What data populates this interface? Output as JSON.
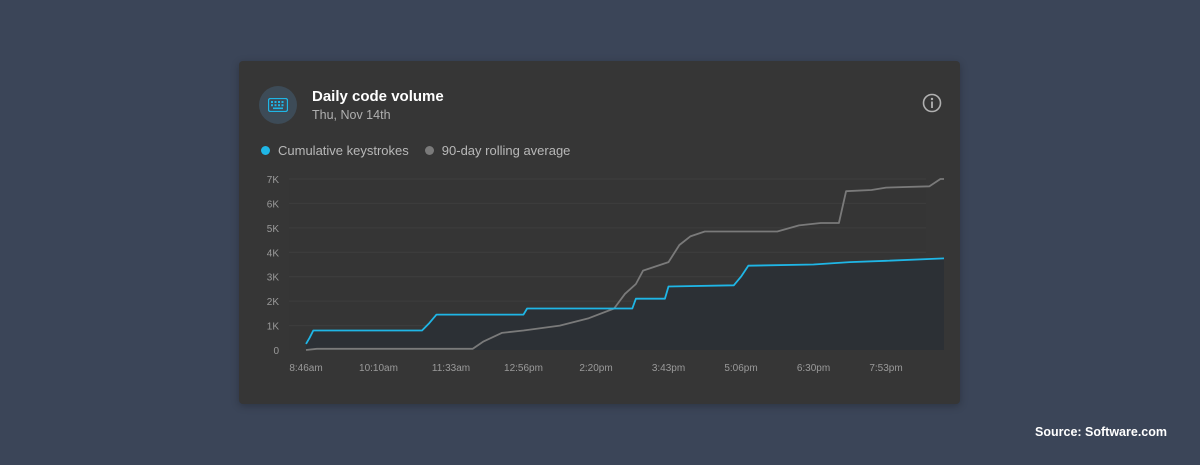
{
  "card": {
    "title": "Daily code volume",
    "subtitle": "Thu, Nov 14th",
    "icon": "keyboard-icon",
    "info_icon": "info-icon"
  },
  "legend": [
    {
      "label": "Cumulative keystrokes",
      "color": "#1fb6e6"
    },
    {
      "label": "90-day rolling average",
      "color": "#7a7a7a"
    }
  ],
  "source": "Source: Software.com",
  "colors": {
    "page_bg": "#3b4558",
    "card_bg": "#363636",
    "keystrokes": "#1fb6e6",
    "average": "#7a7a7a"
  },
  "chart_data": {
    "type": "line",
    "title": "Daily code volume",
    "x_ticks": [
      "8:46am",
      "10:10am",
      "11:33am",
      "12:56pm",
      "2:20pm",
      "3:43pm",
      "5:06pm",
      "6:30pm",
      "7:53pm"
    ],
    "y_ticks": [
      "0",
      "1K",
      "2K",
      "3K",
      "4K",
      "5K",
      "6K",
      "7K"
    ],
    "ylim": [
      0,
      7000
    ],
    "grid": true,
    "series": [
      {
        "name": "Cumulative keystrokes",
        "color": "#1fb6e6",
        "fill": true,
        "points": [
          [
            0,
            250
          ],
          [
            0.05,
            500
          ],
          [
            0.1,
            800
          ],
          [
            1.6,
            800
          ],
          [
            1.7,
            1100
          ],
          [
            1.8,
            1450
          ],
          [
            3.0,
            1450
          ],
          [
            3.05,
            1700
          ],
          [
            4.5,
            1700
          ],
          [
            4.55,
            2100
          ],
          [
            4.95,
            2100
          ],
          [
            5.0,
            2600
          ],
          [
            5.9,
            2650
          ],
          [
            6.0,
            3000
          ],
          [
            6.1,
            3450
          ],
          [
            7.0,
            3500
          ],
          [
            7.5,
            3600
          ],
          [
            8.0,
            3650
          ],
          [
            8.8,
            3750
          ]
        ]
      },
      {
        "name": "90-day rolling average",
        "color": "#7a7a7a",
        "fill": false,
        "points": [
          [
            0,
            0
          ],
          [
            0.15,
            50
          ],
          [
            2.3,
            50
          ],
          [
            2.45,
            350
          ],
          [
            2.7,
            700
          ],
          [
            3.0,
            800
          ],
          [
            3.5,
            1000
          ],
          [
            3.9,
            1300
          ],
          [
            4.25,
            1700
          ],
          [
            4.4,
            2300
          ],
          [
            4.55,
            2700
          ],
          [
            4.65,
            3250
          ],
          [
            5.0,
            3600
          ],
          [
            5.15,
            4300
          ],
          [
            5.3,
            4650
          ],
          [
            5.5,
            4850
          ],
          [
            6.5,
            4850
          ],
          [
            6.8,
            5100
          ],
          [
            7.1,
            5200
          ],
          [
            7.35,
            5200
          ],
          [
            7.45,
            6500
          ],
          [
            7.8,
            6550
          ],
          [
            8.0,
            6650
          ],
          [
            8.6,
            6700
          ],
          [
            8.75,
            7000
          ],
          [
            8.8,
            7000
          ]
        ]
      }
    ]
  }
}
